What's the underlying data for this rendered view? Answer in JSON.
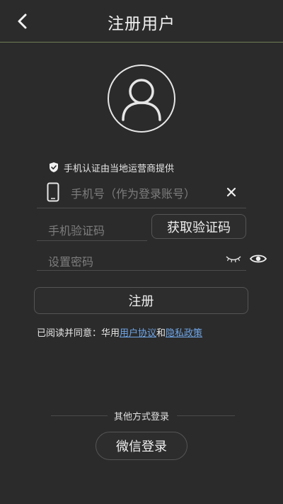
{
  "header": {
    "title": "注册用户",
    "back_icon": "chevron-left-icon"
  },
  "avatar": {
    "icon": "user-icon"
  },
  "notice": {
    "text": "手机认证由当地运营商提供",
    "icon": "shield-check-icon"
  },
  "phone": {
    "placeholder": "手机号（作为登录账号）",
    "icon": "phone-icon",
    "clear_icon": "close-icon"
  },
  "code": {
    "placeholder": "手机验证码",
    "button_label": "获取验证码"
  },
  "password": {
    "placeholder": "设置密码",
    "hide_icon": "eye-closed-icon",
    "show_icon": "eye-icon"
  },
  "register": {
    "label": "注册"
  },
  "agreement": {
    "prefix": "已阅读并同意：华用",
    "user_agreement": "用户协议",
    "and": "和",
    "privacy_policy": "隐私政策"
  },
  "other_login": {
    "label": "其他方式登录",
    "wechat_label": "微信登录"
  },
  "colors": {
    "background": "#2b2b2b",
    "link": "#6fa6e8",
    "header_border": "#6f7d55"
  }
}
